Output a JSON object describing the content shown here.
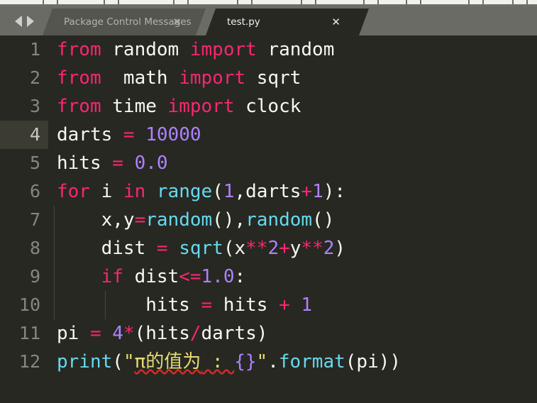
{
  "window": {
    "app": "Sublime Text",
    "theme_bg": "#272822",
    "tabbar_bg": "#6b6b66",
    "accent_keyword": "#f92672",
    "accent_function": "#66d9ef",
    "accent_number": "#ae81ff",
    "accent_string": "#e6db74"
  },
  "tabbar": {
    "nav_prev_icon": "arrow-left-icon",
    "nav_next_icon": "arrow-right-icon",
    "tabs": [
      {
        "label": "Package Control Messages",
        "close_label": "✕",
        "active": false
      },
      {
        "label": "test.py",
        "close_label": "✕",
        "active": true
      }
    ]
  },
  "editor": {
    "language": "Python",
    "active_line": 4,
    "lines": [
      {
        "number": "1",
        "text": "from random import random"
      },
      {
        "number": "2",
        "text": "from  math import sqrt"
      },
      {
        "number": "3",
        "text": "from time import clock"
      },
      {
        "number": "4",
        "text": "darts = 10000"
      },
      {
        "number": "5",
        "text": "hits = 0.0"
      },
      {
        "number": "6",
        "text": "for i in range(1,darts+1):"
      },
      {
        "number": "7",
        "text": "    x,y=random(),random()"
      },
      {
        "number": "8",
        "text": "    dist = sqrt(x**2+y**2)"
      },
      {
        "number": "9",
        "text": "    if dist<=1.0:"
      },
      {
        "number": "10",
        "text": "        hits = hits + 1"
      },
      {
        "number": "11",
        "text": "pi = 4*(hits/darts)"
      },
      {
        "number": "12",
        "text": "print(\"π的值为 : {}\".format(pi))"
      }
    ],
    "tokens": {
      "l1": {
        "t1": "from",
        "t2": " random ",
        "t3": "import",
        "t4": " random"
      },
      "l2": {
        "t1": "from",
        "t2": "  math ",
        "t3": "import",
        "t4": " sqrt"
      },
      "l3": {
        "t1": "from",
        "t2": " time ",
        "t3": "import",
        "t4": " clock"
      },
      "l4": {
        "t1": "darts ",
        "t2": "=",
        "t3": " ",
        "t4": "10000"
      },
      "l5": {
        "t1": "hits ",
        "t2": "=",
        "t3": " ",
        "t4": "0.0"
      },
      "l6": {
        "t1": "for",
        "t2": " i ",
        "t3": "in",
        "t4": " ",
        "t5": "range",
        "t6": "(",
        "t7": "1",
        "t8": ",darts",
        "t9": "+",
        "t10": "1",
        "t11": "):"
      },
      "l7": {
        "t1": "    x,y",
        "t2": "=",
        "t3": "random",
        "t4": "(),",
        "t5": "random",
        "t6": "()"
      },
      "l8": {
        "t1": "    dist ",
        "t2": "=",
        "t3": " ",
        "t4": "sqrt",
        "t5": "(x",
        "t6": "**",
        "t7": "2",
        "t8": "+",
        "t9": "y",
        "t10": "**",
        "t11": "2",
        "t12": ")"
      },
      "l9": {
        "t1": "    ",
        "t2": "if",
        "t3": " dist",
        "t4": "<=",
        "t5": "1.0",
        "t6": ":"
      },
      "l10": {
        "t1": "        hits ",
        "t2": "=",
        "t3": " hits ",
        "t4": "+",
        "t5": " ",
        "t6": "1"
      },
      "l11": {
        "t1": "pi ",
        "t2": "=",
        "t3": " ",
        "t4": "4",
        "t5": "*",
        "t6": "(hits",
        "t7": "/",
        "t8": "darts)"
      },
      "l12": {
        "t1": "print",
        "t2": "(",
        "t3": "\"",
        "t4": "π的值为",
        "t5": " : ",
        "t6": "{}",
        "t7": "\"",
        "t8": ".",
        "t9": "format",
        "t10": "(pi))"
      }
    }
  }
}
